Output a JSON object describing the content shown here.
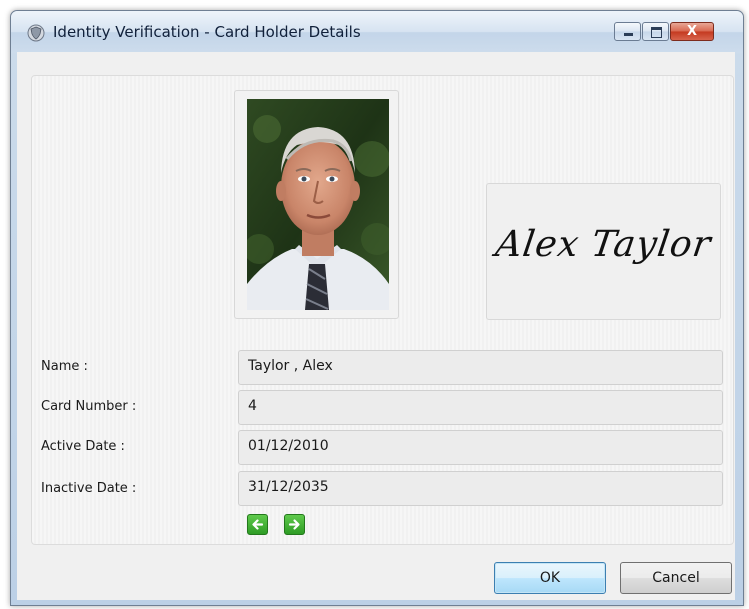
{
  "window": {
    "title": "Identity Verification - Card Holder Details",
    "close_glyph": "X"
  },
  "card": {
    "signature": "Alex Taylor",
    "fields": [
      {
        "label": "Name :",
        "value": "Taylor , Alex"
      },
      {
        "label": "Card Number :",
        "value": "4"
      },
      {
        "label": "Active Date :",
        "value": "01/12/2010"
      },
      {
        "label": "Inactive Date :",
        "value": "31/12/2035"
      }
    ]
  },
  "nav": {
    "prev_icon": "arrow-left-icon",
    "next_icon": "arrow-right-icon"
  },
  "buttons": {
    "ok": "OK",
    "cancel": "Cancel"
  },
  "colors": {
    "nav_green": "#2e9c25",
    "close_red": "#c4391f",
    "ok_border": "#3c7fb1"
  }
}
